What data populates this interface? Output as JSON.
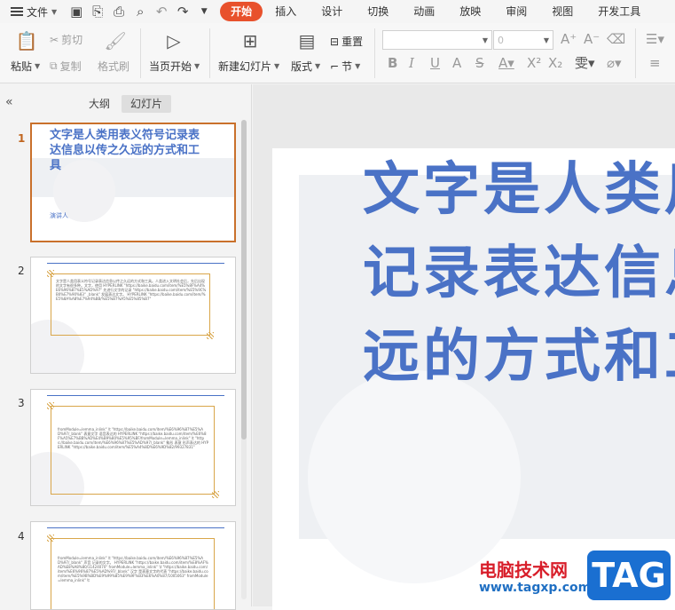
{
  "menubar": {
    "file_label": "文件",
    "tabs": [
      "开始",
      "插入",
      "设计",
      "切换",
      "动画",
      "放映",
      "审阅",
      "视图",
      "开发工具"
    ],
    "active_tab": "开始"
  },
  "ribbon": {
    "paste": "粘贴",
    "cut": "剪切",
    "copy": "复制",
    "format_painter": "格式刷",
    "from_current": "当页开始",
    "new_slide": "新建幻灯片",
    "layout": "版式",
    "reset": "重置",
    "section": "节",
    "font_size_value": "0"
  },
  "panel": {
    "tab_outline": "大纲",
    "tab_slides": "幻灯片",
    "active_tab": "幻灯片"
  },
  "slides": [
    {
      "number": "1",
      "title": "文字是人类用表义符号记录表达信息以传之久远的方式和工具",
      "speaker": "演讲人"
    },
    {
      "number": "2",
      "body": "文字是人类用表义符号记录表达信息以传之久远的方式和工具。人类进入文明社会后，先后出现的文字有很多种。文字，使用 HYPERLINK \"https://baike.baidu.com/item/%E5%8F%A4%E6%96%87%E5%AD%97\" 先进行文字的记录 \"https://baike.baidu.com/item/%E5%9C%B0%E7%90%83\" _blank\" 发展表达文字。 HYPERLINK \"https://baike.baidu.com/item/%E5%8A%A8%E7%94%BB/%E5%B7%A5%E5%85%B7\""
    },
    {
      "number": "3",
      "body": "fromModule=lemma_inlink\" \\t \"https://baike.baidu.com/item/%E6%96%87%E5%AD%97/_blank\" 表意文字 语音表达的 HYPERLINK \"https://baike.baidu.com/item/%E6%8F%A5%E7%BB%AD%E4%B9%80%E5%95%BF/fromModule=lemma_inlink\" \\t \"https://baike.baidu.com/item/%E6%96%87%E5%AD%97/_blank\" 象形 表意 形声表达的 HYPERLINK \"https://baike.baidu.com/item/%E5%A4%8D%E6%9D%82/99327831\""
    },
    {
      "number": "4",
      "body": "fromModule=lemma_inlink\" \\t \"https://baike.baidu.com/item/%E6%96%87%E5%AD%97/_blank\" 声音 记录的文字。 HYPERLINK \"https://baike.baidu.com/item/%E8%AF%AD%E8%A8%80/11424070\" fromModule=lemma_inlink\" \\t \"https://baike.baidu.com/item/%E6%96%87%E5%AD%97/_blank\" 汉字 是表意文字的代表 \"https://baike.baidu.com/item/%E5%9B%BD%E9%99%85%E9%9F%B3%E6%A0%87/1005063\" fromModule=lemma_inlink\" \\t"
    }
  ],
  "canvas": {
    "title_lines": [
      "文字是人类用",
      "记录表达信息",
      "远的方式和工"
    ]
  },
  "watermark": {
    "site_name": "电脑技术网",
    "url": "www.tagxp.com",
    "tag": "TAG"
  },
  "colors": {
    "accent": "#e8512c",
    "title_blue": "#4a72c6",
    "selection_orange": "#c9702b",
    "box_gold": "#d9a64a"
  }
}
